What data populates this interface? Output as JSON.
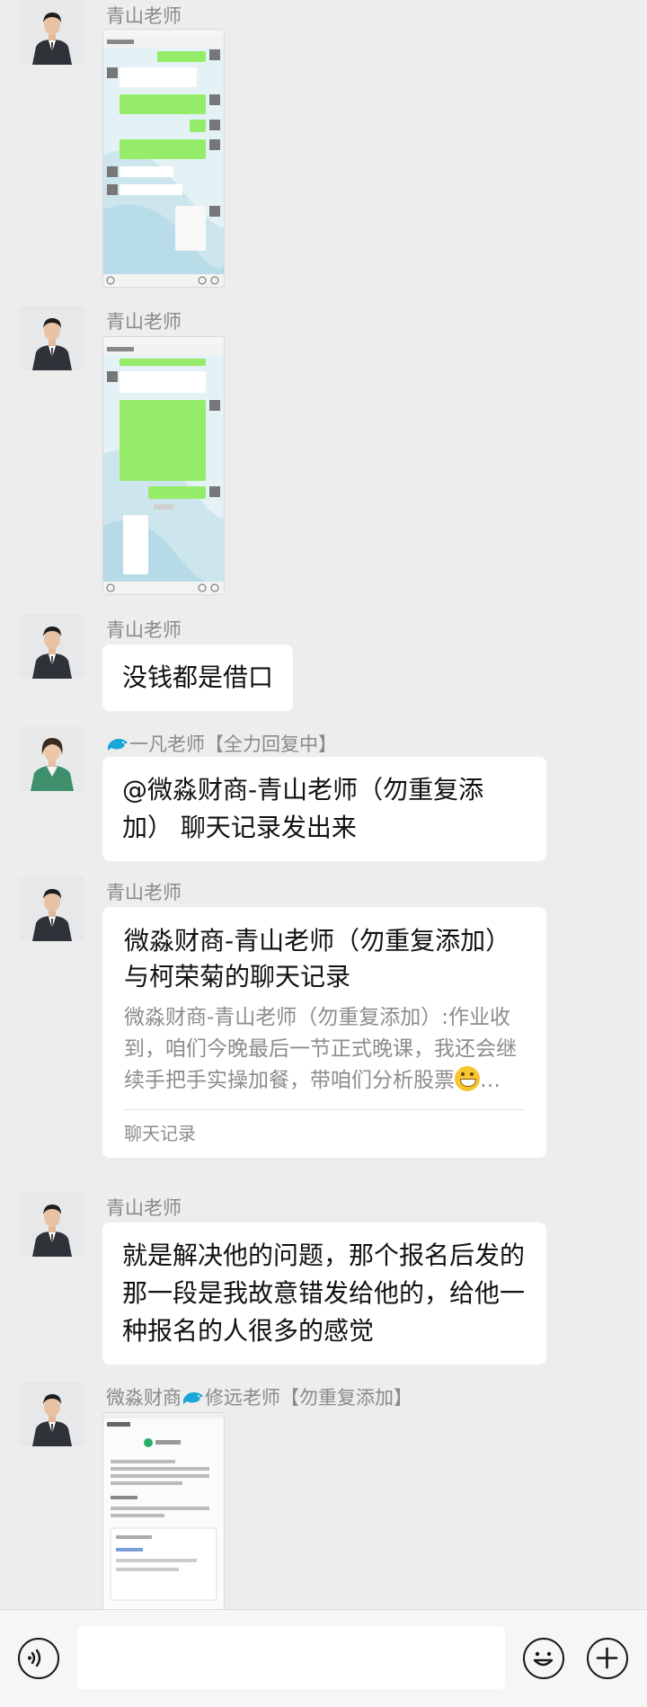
{
  "colors": {
    "background": "#ededed",
    "bubble": "#ffffff",
    "sender_name": "#8a8a8a",
    "wechat_green": "#95ec69"
  },
  "messages": [
    {
      "sender": "青山老师",
      "type": "image",
      "content": "聊天截图",
      "avatar": "man-in-suit"
    },
    {
      "sender": "青山老师",
      "type": "image",
      "content": "聊天截图",
      "avatar": "man-in-suit"
    },
    {
      "sender": "青山老师",
      "type": "text",
      "text": "没钱都是借口",
      "avatar": "man-in-suit"
    },
    {
      "sender": "一凡老师【全力回复中】",
      "sender_icon": "dolphin-icon",
      "type": "text",
      "text": "@微淼财商-青山老师（勿重复添加） 聊天记录发出来",
      "avatar": "woman-in-green"
    },
    {
      "sender": "青山老师",
      "type": "chat_record",
      "avatar": "man-in-suit",
      "title": "微淼财商-青山老师（勿重复添加）与柯荣菊的聊天记录",
      "preview": "微淼财商-青山老师（勿重复添加）:作业收到，咱们今晚最后一节正式晚课，我还会继续手把手实操加餐，带咱们分析股票",
      "preview_suffix": "…",
      "footer": "聊天记录"
    },
    {
      "sender": "青山老师",
      "type": "text",
      "avatar": "man-in-suit",
      "text": "就是解决他的问题，那个报名后发的那一段是我故意错发给他的，给他一种报名的人很多的感觉"
    },
    {
      "sender_prefix": "微淼财商",
      "sender_icon": "dolphin-icon",
      "sender_suffix": "修远老师【勿重复添加】",
      "type": "image",
      "content": "验证成功页面截图",
      "avatar": "man-in-suit"
    }
  ],
  "input_bar": {
    "voice_icon": "voice-icon",
    "emoji_icon": "emoji-icon",
    "plus_icon": "plus-icon",
    "input_value": ""
  }
}
